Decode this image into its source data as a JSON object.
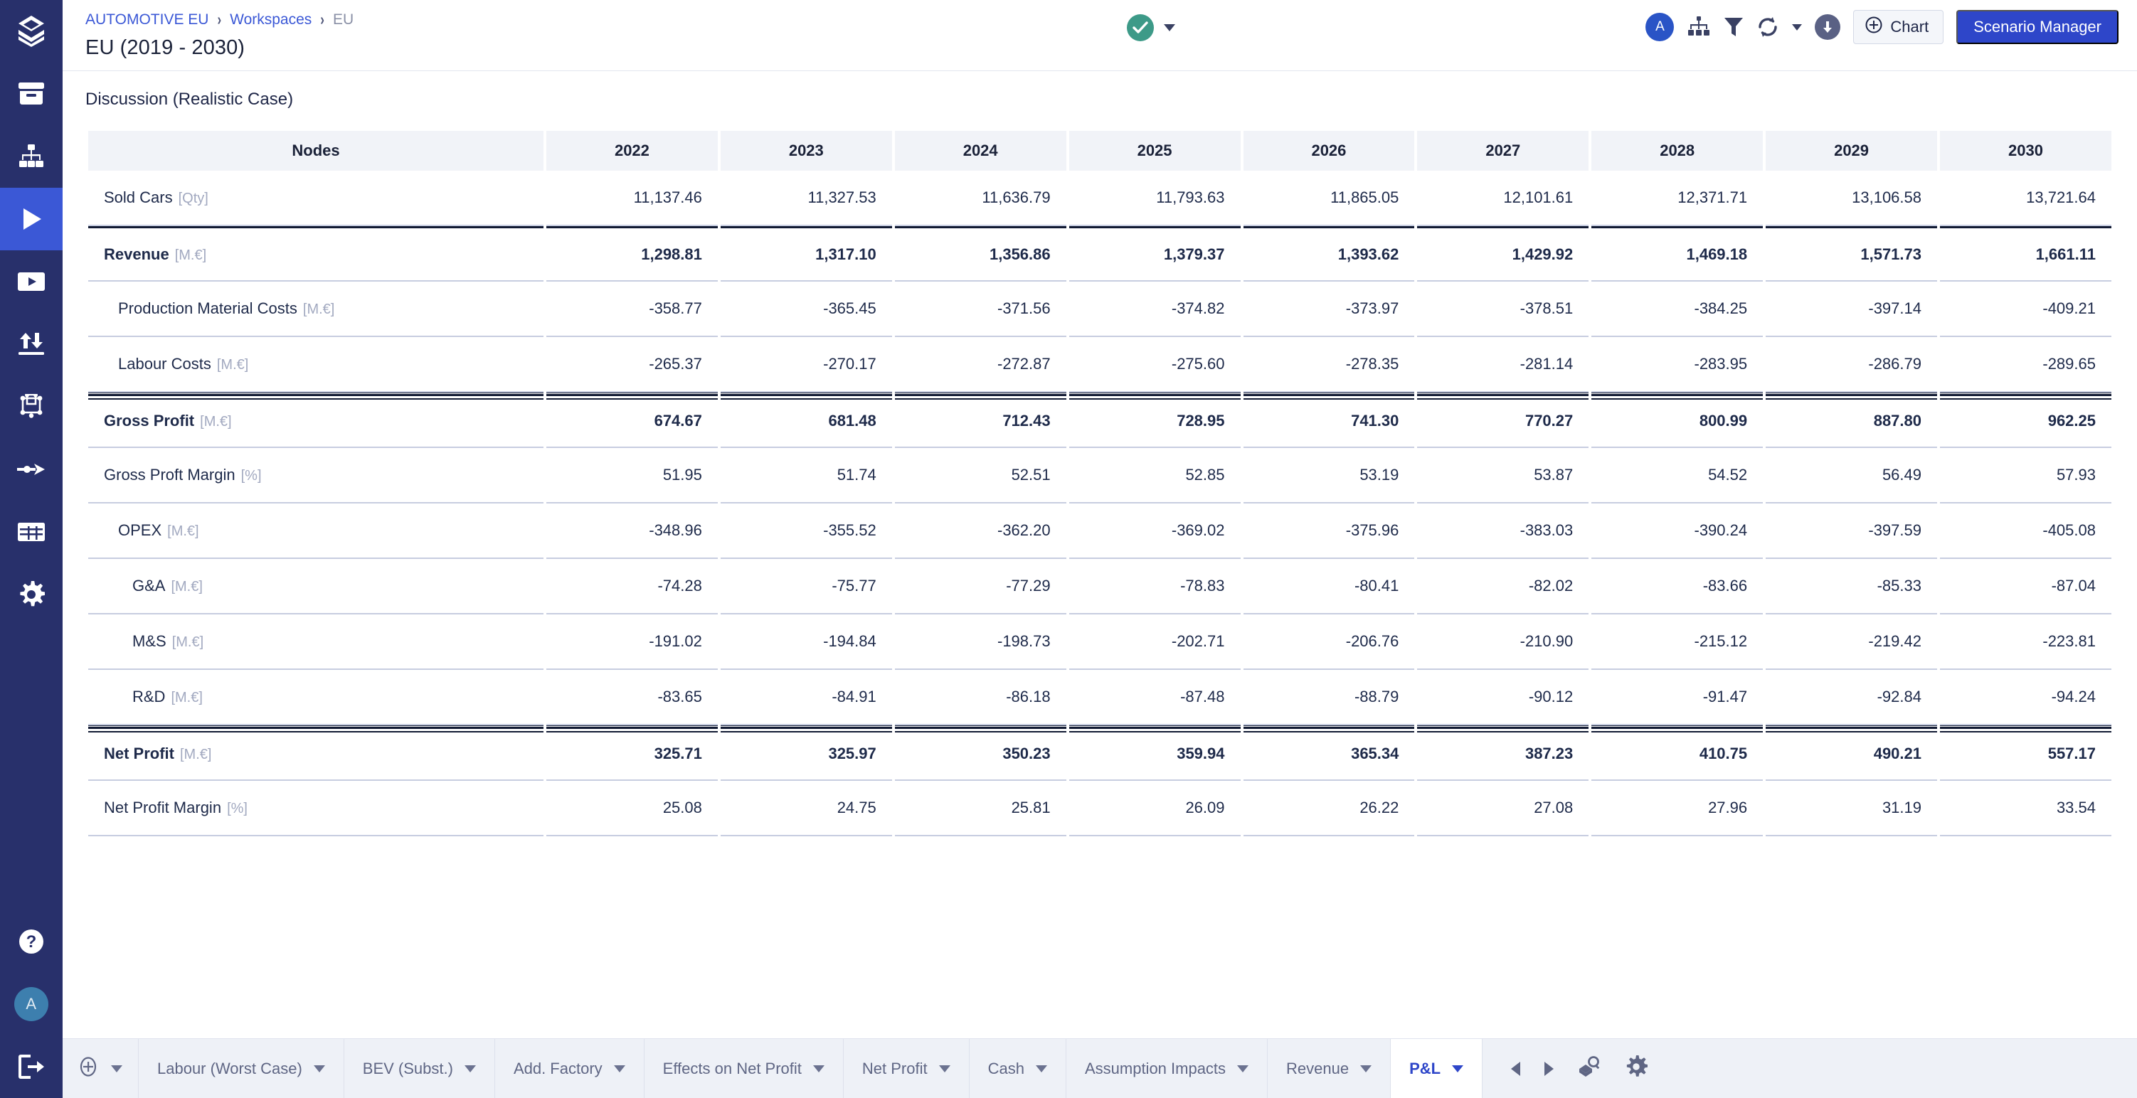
{
  "sidebar": {
    "logo_icon": "stacked-layers-logo",
    "items": [
      {
        "icon": "archive-box-icon",
        "name": "archive",
        "active": false
      },
      {
        "icon": "org-tree-icon",
        "name": "model-tree",
        "active": false
      },
      {
        "icon": "play-icon",
        "name": "run-simulation",
        "active": true
      },
      {
        "icon": "video-frame-icon",
        "name": "presentation",
        "active": false
      },
      {
        "icon": "sort-updown-icon",
        "name": "compare",
        "active": false
      },
      {
        "icon": "bounding-box-icon",
        "name": "canvas",
        "active": false
      },
      {
        "icon": "arrow-right-icon",
        "name": "flow",
        "active": false
      },
      {
        "icon": "table-icon",
        "name": "tables",
        "active": false
      },
      {
        "icon": "gear-icon",
        "name": "settings",
        "active": false
      }
    ],
    "bottom_items": [
      {
        "icon": "help-circle-icon",
        "name": "help"
      },
      {
        "icon": "user-avatar",
        "name": "account",
        "label": "A"
      },
      {
        "icon": "logout-icon",
        "name": "logout"
      }
    ]
  },
  "header": {
    "breadcrumb": [
      {
        "label": "AUTOMOTIVE EU",
        "type": "link"
      },
      {
        "label": "Workspaces",
        "type": "link"
      },
      {
        "label": "EU",
        "type": "current"
      }
    ],
    "separator": "›",
    "title": "EU (2019 - 2030)",
    "status": {
      "icon": "check-circle-icon",
      "color": "#3d9a88",
      "dropdown_icon": "caret-down-icon"
    },
    "actions": [
      {
        "name": "assumptions-avatar",
        "icon": "avatar-a",
        "label": "A"
      },
      {
        "name": "hierarchy-button",
        "icon": "org-tree-icon"
      },
      {
        "name": "filter-button",
        "icon": "funnel-icon"
      },
      {
        "name": "refresh-button",
        "icon": "refresh-icon"
      },
      {
        "name": "refresh-dropdown",
        "icon": "caret-down-icon"
      },
      {
        "name": "download-button",
        "icon": "download-circle-icon"
      }
    ],
    "chart_button": {
      "label": "Chart",
      "icon": "plus-circle-icon"
    },
    "scenario_button": {
      "label": "Scenario Manager"
    }
  },
  "main": {
    "case_label": "Discussion (Realistic Case)"
  },
  "chart_data": {
    "type": "table",
    "title": "Discussion (Realistic Case)",
    "columns": [
      "Nodes",
      "2022",
      "2023",
      "2024",
      "2025",
      "2026",
      "2027",
      "2028",
      "2029",
      "2030"
    ],
    "years": [
      "2022",
      "2023",
      "2024",
      "2025",
      "2026",
      "2027",
      "2028",
      "2029",
      "2030"
    ],
    "rows": [
      {
        "label": "Sold Cars",
        "unit": "[Qty]",
        "indent": 0,
        "bold": false,
        "rule": "none",
        "values": [
          "11,137.46",
          "11,327.53",
          "11,636.79",
          "11,793.63",
          "11,865.05",
          "12,101.61",
          "12,371.71",
          "13,106.58",
          "13,721.64"
        ]
      },
      {
        "label": "Revenue",
        "unit": "[M.€]",
        "indent": 0,
        "bold": true,
        "rule": "single",
        "values": [
          "1,298.81",
          "1,317.10",
          "1,356.86",
          "1,379.37",
          "1,393.62",
          "1,429.92",
          "1,469.18",
          "1,571.73",
          "1,661.11"
        ]
      },
      {
        "label": "Production Material Costs",
        "unit": "[M.€]",
        "indent": 1,
        "bold": false,
        "rule": "none",
        "values": [
          "-358.77",
          "-365.45",
          "-371.56",
          "-374.82",
          "-373.97",
          "-378.51",
          "-384.25",
          "-397.14",
          "-409.21"
        ]
      },
      {
        "label": "Labour Costs",
        "unit": "[M.€]",
        "indent": 1,
        "bold": false,
        "rule": "none",
        "values": [
          "-265.37",
          "-270.17",
          "-272.87",
          "-275.60",
          "-278.35",
          "-281.14",
          "-283.95",
          "-286.79",
          "-289.65"
        ]
      },
      {
        "label": "Gross Profit",
        "unit": "[M.€]",
        "indent": 0,
        "bold": true,
        "rule": "double",
        "values": [
          "674.67",
          "681.48",
          "712.43",
          "728.95",
          "741.30",
          "770.27",
          "800.99",
          "887.80",
          "962.25"
        ]
      },
      {
        "label": "Gross Proft Margin",
        "unit": "[%]",
        "indent": 0,
        "bold": false,
        "rule": "none",
        "values": [
          "51.95",
          "51.74",
          "52.51",
          "52.85",
          "53.19",
          "53.87",
          "54.52",
          "56.49",
          "57.93"
        ]
      },
      {
        "label": "OPEX",
        "unit": "[M.€]",
        "indent": 1,
        "bold": false,
        "rule": "none",
        "values": [
          "-348.96",
          "-355.52",
          "-362.20",
          "-369.02",
          "-375.96",
          "-383.03",
          "-390.24",
          "-397.59",
          "-405.08"
        ]
      },
      {
        "label": "G&A",
        "unit": "[M.€]",
        "indent": 2,
        "bold": false,
        "rule": "none",
        "values": [
          "-74.28",
          "-75.77",
          "-77.29",
          "-78.83",
          "-80.41",
          "-82.02",
          "-83.66",
          "-85.33",
          "-87.04"
        ]
      },
      {
        "label": "M&S",
        "unit": "[M.€]",
        "indent": 2,
        "bold": false,
        "rule": "none",
        "values": [
          "-191.02",
          "-194.84",
          "-198.73",
          "-202.71",
          "-206.76",
          "-210.90",
          "-215.12",
          "-219.42",
          "-223.81"
        ]
      },
      {
        "label": "R&D",
        "unit": "[M.€]",
        "indent": 2,
        "bold": false,
        "rule": "none",
        "values": [
          "-83.65",
          "-84.91",
          "-86.18",
          "-87.48",
          "-88.79",
          "-90.12",
          "-91.47",
          "-92.84",
          "-94.24"
        ]
      },
      {
        "label": "Net Profit",
        "unit": "[M.€]",
        "indent": 0,
        "bold": true,
        "rule": "double",
        "values": [
          "325.71",
          "325.97",
          "350.23",
          "359.94",
          "365.34",
          "387.23",
          "410.75",
          "490.21",
          "557.17"
        ]
      },
      {
        "label": "Net Profit Margin",
        "unit": "[%]",
        "indent": 0,
        "bold": false,
        "rule": "none",
        "values": [
          "25.08",
          "24.75",
          "25.81",
          "26.09",
          "26.22",
          "27.08",
          "27.96",
          "31.19",
          "33.54"
        ]
      }
    ]
  },
  "tabbar": {
    "add_tab": {
      "label": "",
      "icon": "plus-circle-icon",
      "dropdown_icon": "chevron-down-icon"
    },
    "tabs": [
      {
        "label": "Labour (Worst Case)",
        "active": false
      },
      {
        "label": "BEV (Subst.)",
        "active": false
      },
      {
        "label": "Add. Factory",
        "active": false
      },
      {
        "label": "Effects on Net Profit",
        "active": false
      },
      {
        "label": "Net Profit",
        "active": false
      },
      {
        "label": "Cash",
        "active": false
      },
      {
        "label": "Assumption Impacts",
        "active": false
      },
      {
        "label": "Revenue",
        "active": false
      },
      {
        "label": "P&L",
        "active": true
      }
    ],
    "nav": [
      {
        "name": "prev-tab-button",
        "icon": "triangle-left-icon"
      },
      {
        "name": "next-tab-button",
        "icon": "triangle-right-icon"
      },
      {
        "name": "find-tab-button",
        "icon": "search-layers-icon"
      },
      {
        "name": "tab-settings-button",
        "icon": "gear-icon"
      }
    ]
  }
}
